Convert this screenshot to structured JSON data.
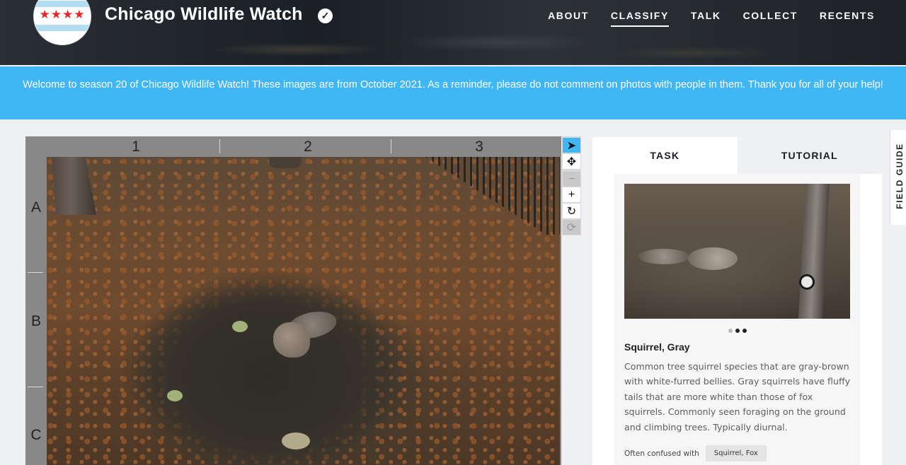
{
  "header": {
    "title": "Chicago Wildlife Watch",
    "logo_stars": "★★★★",
    "verified_icon": "✓",
    "nav": [
      {
        "label": "ABOUT"
      },
      {
        "label": "CLASSIFY",
        "active": true
      },
      {
        "label": "TALK"
      },
      {
        "label": "COLLECT"
      },
      {
        "label": "RECENTS"
      }
    ]
  },
  "banner": {
    "text": "Welcome to season 20 of Chicago Wildlife Watch! These images are from October 2021. As a reminder, please do not comment on photos with people in them. Thank you for all of your help!"
  },
  "viewer": {
    "columns": [
      "1",
      "2",
      "3"
    ],
    "rows": [
      "A",
      "B",
      "C"
    ],
    "tools": [
      {
        "name": "pointer-icon",
        "glyph": "➤"
      },
      {
        "name": "move-icon",
        "glyph": "✥"
      },
      {
        "name": "zoom-out-icon",
        "glyph": "−"
      },
      {
        "name": "zoom-in-icon",
        "glyph": "+"
      },
      {
        "name": "rotate-icon",
        "glyph": "↻"
      },
      {
        "name": "reset-icon",
        "glyph": "⟳"
      }
    ]
  },
  "panel": {
    "tabs": [
      "TASK",
      "TUTORIAL"
    ],
    "species_name": "Squirrel, Gray",
    "description": "Common tree squirrel species that are gray-brown with white-furred bellies. Gray squirrels have fluffy tails that are more white than those of fox squirrels. Commonly seen foraging on the ground and climbing trees. Typically diurnal.",
    "confused_label": "Often confused with",
    "confused_with": "Squirrel, Fox"
  },
  "field_guide": {
    "label": "FIELD GUIDE"
  },
  "colors": {
    "banner": "#40b6f4",
    "active_tool": "#40b6f4"
  }
}
